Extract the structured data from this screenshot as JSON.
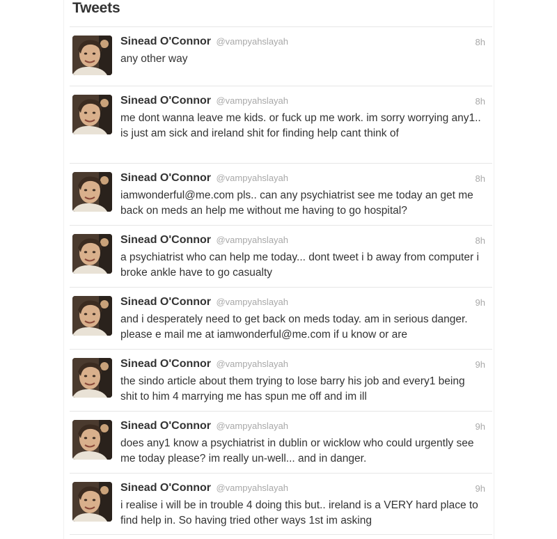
{
  "section_title": "Tweets",
  "tweets": [
    {
      "name": "Sinead O'Connor",
      "handle": "@vampyahslayah",
      "time": "8h",
      "text": "any other way"
    },
    {
      "name": "Sinead O'Connor",
      "handle": "@vampyahslayah",
      "time": "8h",
      "text": "me dont wanna leave me kids. or fuck up me work. im sorry worrying any1.. is just am sick and ireland shit for finding help cant think of"
    },
    {
      "name": "Sinead O'Connor",
      "handle": "@vampyahslayah",
      "time": "8h",
      "text": "iamwonderful@me.com pls.. can any psychiatrist see me today an get me back on meds an help me without me having to go hospital?"
    },
    {
      "name": "Sinead O'Connor",
      "handle": "@vampyahslayah",
      "time": "8h",
      "text": "a psychiatrist who can help me today... dont tweet i b away from computer i broke ankle have to go casualty"
    },
    {
      "name": "Sinead O'Connor",
      "handle": "@vampyahslayah",
      "time": "9h",
      "text": "and i desperately need to get back on meds today. am in serious danger. please e mail me at iamwonderful@me.com if u know or are"
    },
    {
      "name": "Sinead O'Connor",
      "handle": "@vampyahslayah",
      "time": "9h",
      "text": "the sindo article about them trying to lose barry his job and every1 being shit to him 4 marrying me has spun me off and im ill"
    },
    {
      "name": "Sinead O'Connor",
      "handle": "@vampyahslayah",
      "time": "9h",
      "text": "does any1 know a psychiatrist in dublin or wicklow who could urgently see me today please? im really un-well... and in danger."
    },
    {
      "name": "Sinead O'Connor",
      "handle": "@vampyahslayah",
      "time": "9h",
      "text": "i realise i will be in trouble 4 doing this but.. ireland is a VERY hard place to find help in. So having tried other ways 1st im asking"
    }
  ]
}
